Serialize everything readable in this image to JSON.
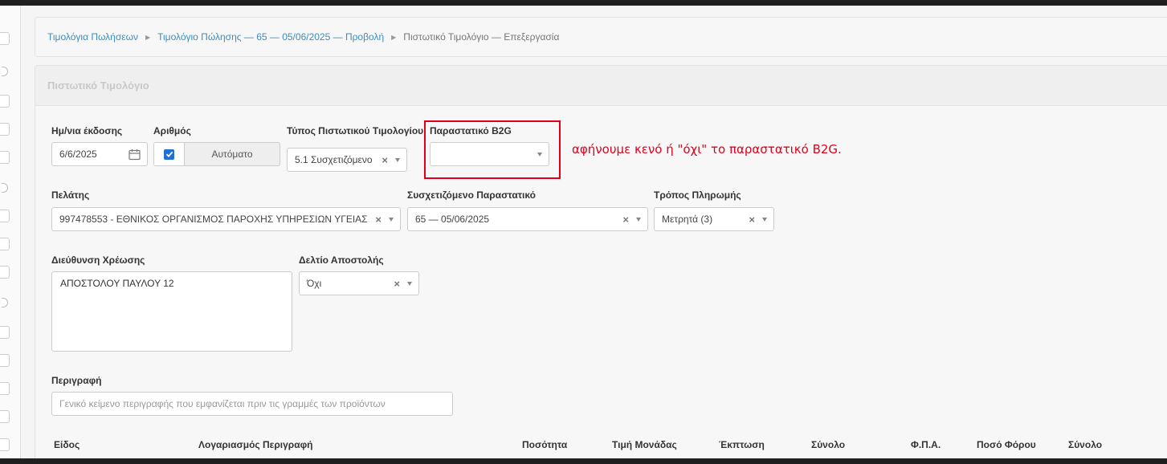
{
  "breadcrumb": {
    "items": [
      "Τιμολόγια Πωλήσεων",
      "Τιμολόγιο Πώλησης — 65 — 05/06/2025 — Προβολή"
    ],
    "current": "Πιστωτικό Τιμολόγιο — Επεξεργασία"
  },
  "panel": {
    "title": "Πιστωτικό Τιμολόγιο"
  },
  "form": {
    "issue_date": {
      "label": "Ημ/νια έκδοσης",
      "value": "6/6/2025"
    },
    "number": {
      "label": "Αριθμός",
      "checked": true,
      "button": "Αυτόματο"
    },
    "credit_type": {
      "label": "Τύπος Πιστωτικού Τιμολογίου",
      "value": "5.1 Συσχετιζόμενο"
    },
    "b2g": {
      "label": "Παραστατικό B2G",
      "value": ""
    },
    "customer": {
      "label": "Πελάτης",
      "value": "997478553 - ΕΘΝΙΚΟΣ ΟΡΓΑΝΙΣΜΟΣ ΠΑΡΟΧΗΣ ΥΠΗΡΕΣΙΩΝ ΥΓΕΙΑΣ"
    },
    "related_doc": {
      "label": "Συσχετιζόμενο Παραστατικό",
      "value": "65 — 05/06/2025"
    },
    "payment": {
      "label": "Τρόπος Πληρωμής",
      "value": "Μετρητά (3)"
    },
    "billing_address": {
      "label": "Διεύθυνση Χρέωσης",
      "value": "ΑΠΟΣΤΟΛΟΥ ΠΑΥΛΟΥ 12"
    },
    "delivery_note": {
      "label": "Δελτίο Αποστολής",
      "value": "Όχι"
    },
    "description": {
      "label": "Περιγραφή",
      "placeholder": "Γενικό κείμενο περιγραφής που εμφανίζεται πριν τις γραμμές των προϊόντων"
    }
  },
  "annotation": {
    "text": "αφήνουμε κενό ή \"όχι\" το παραστατικό B2G.",
    "color": "#e0001b"
  },
  "table": {
    "headers": [
      "Είδος",
      "Λογαριασμός",
      "Περιγραφή",
      "Ποσότητα",
      "Τιμή Μονάδας",
      "Έκπτωση",
      "Σύνολο",
      "Φ.Π.Α.",
      "Ποσό Φόρου",
      "Σύνολο"
    ]
  },
  "icons": {
    "calendar": "calendar-icon",
    "clear": "clear-icon",
    "dropdown": "chevron-down-icon",
    "checkbox": "check-icon"
  },
  "colors": {
    "link": "#3c8dbc",
    "checkbox": "#1f6fd6",
    "highlight": "#e0001b"
  }
}
